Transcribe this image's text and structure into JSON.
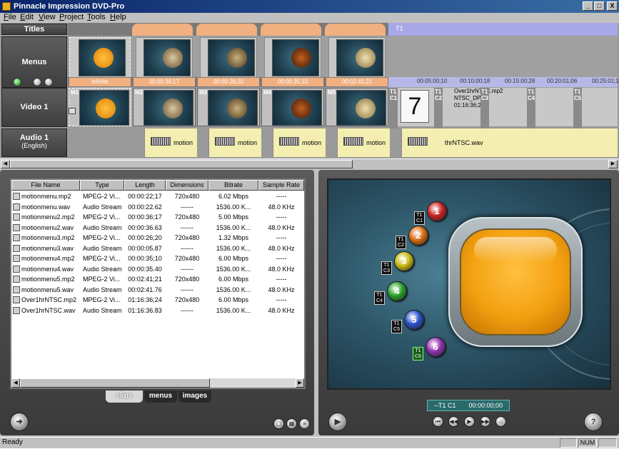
{
  "window": {
    "title": "Pinnacle Impression DVD-Pro",
    "controls": [
      "_",
      "□",
      "X"
    ]
  },
  "menu": [
    "File",
    "Edit",
    "View",
    "Project",
    "Tools",
    "Help"
  ],
  "timeline": {
    "tracks": {
      "titles": "Titles",
      "menus": "Menus",
      "video": "Video 1",
      "audio": "Audio 1",
      "audio_sub": "(English)"
    },
    "title_marker": "T1",
    "menu_times": [
      "Infinite",
      "00:00:36;17",
      "00:00:26;20",
      "00:00:35;10",
      "00:02:41;21"
    ],
    "ruler_ticks": [
      "00:05:00;10",
      "00:10:00;18",
      "00:15:00;28",
      "00:20:01;06",
      "00:25:01;16"
    ],
    "video_tags": [
      "M1",
      "M2",
      "M3",
      "M4",
      "M5"
    ],
    "chapter_tags": [
      {
        "t": "T1",
        "c": "C1"
      },
      {
        "t": "T1",
        "c": "C2"
      },
      {
        "t": "T1",
        "c": "C3"
      },
      {
        "t": "T1",
        "c": "C4"
      },
      {
        "t": "T1",
        "c": "C5"
      }
    ],
    "countdown": "7",
    "video_clip_label_1": "Over1hrNTSC.mp2",
    "video_clip_label_2": "NTSC_DP",
    "video_clip_label_3": "01:16:36;2",
    "audio_label": "motion",
    "audio_tail": "thrNTSC.wav"
  },
  "file_list": {
    "columns": [
      "File Name",
      "Type",
      "Length",
      "Dimensions",
      "Bitrate",
      "Sample Rate"
    ],
    "rows": [
      [
        "motionmenu.mp2",
        "MPEG-2 Vi...",
        "00:00:22;17",
        "720x480",
        "6.02 Mbps",
        "-----"
      ],
      [
        "motionmenu.wav",
        "Audio Stream",
        "00:00:22.62",
        "------",
        "1536.00 K...",
        "48.0 KHz"
      ],
      [
        "motionmenu2.mp2",
        "MPEG-2 Vi...",
        "00:00:36;17",
        "720x480",
        "5.00 Mbps",
        "-----"
      ],
      [
        "motionmenu2.wav",
        "Audio Stream",
        "00:00:36.63",
        "------",
        "1536.00 K...",
        "48.0 KHz"
      ],
      [
        "motionmenu3.mp2",
        "MPEG-2 Vi...",
        "00:00:26;20",
        "720x480",
        "1.32 Mbps",
        "-----"
      ],
      [
        "motionmenu3.wav",
        "Audio Stream",
        "00:00:05.87",
        "------",
        "1536.00 K...",
        "48.0 KHz"
      ],
      [
        "motionmenu4.mp2",
        "MPEG-2 Vi...",
        "00:00:35;10",
        "720x480",
        "6.00 Mbps",
        "-----"
      ],
      [
        "motionmenu4.wav",
        "Audio Stream",
        "00:00:35.40",
        "------",
        "1536.00 K...",
        "48.0 KHz"
      ],
      [
        "motionmenu5.mp2",
        "MPEG-2 Vi...",
        "00:02:41;21",
        "720x480",
        "6.00 Mbps",
        "-----"
      ],
      [
        "motionmenu5.wav",
        "Audio Stream",
        "00:02:41.76",
        "------",
        "1536.00 K...",
        "48.0 KHz"
      ],
      [
        "Over1hrNTSC.mp2",
        "MPEG-2 Vi...",
        "01:16:36;24",
        "720x480",
        "6.00 Mbps",
        "-----"
      ],
      [
        "Over1hrNTSC.wav",
        "Audio Stream",
        "01:16:36.83",
        "------",
        "1536.00 K...",
        "48.0 KHz"
      ]
    ]
  },
  "tabs": [
    "clips",
    "menus",
    "images"
  ],
  "preview": {
    "buttons": [
      {
        "num": "1",
        "t": "T1",
        "c": "C1",
        "color": "#c82020"
      },
      {
        "num": "2",
        "t": "T1",
        "c": "C2",
        "color": "#d86a10"
      },
      {
        "num": "3",
        "t": "T1",
        "c": "C3",
        "color": "#c8b810"
      },
      {
        "num": "4",
        "t": "T1",
        "c": "C4",
        "color": "#28a028"
      },
      {
        "num": "5",
        "t": "T1",
        "c": "C5",
        "color": "#2850c8"
      },
      {
        "num": "6",
        "t": "T1",
        "c": "C6",
        "color": "#9030b0"
      }
    ],
    "timecode_chapter": "--T1 C1",
    "timecode_value": "00:00:00;00"
  },
  "status": {
    "text": "Ready",
    "num": "NUM"
  }
}
